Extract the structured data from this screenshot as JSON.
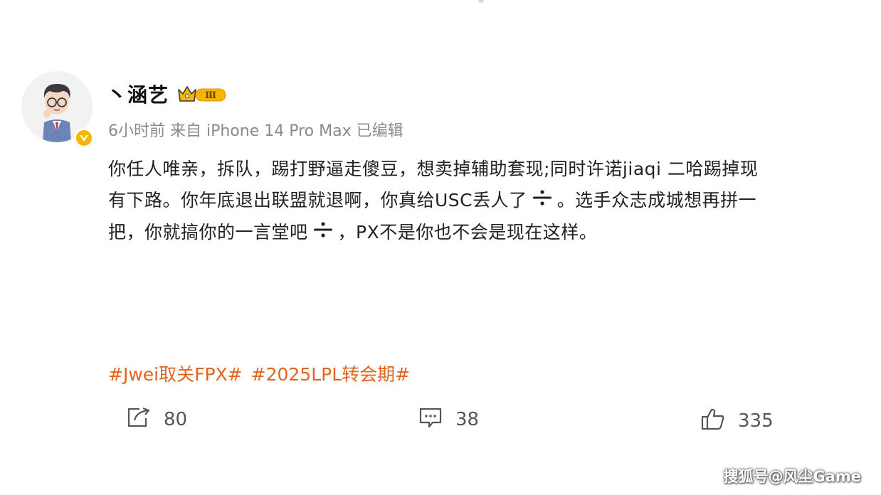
{
  "user": {
    "name": "丶涵艺",
    "vip_level": "Ⅲ"
  },
  "meta": "6小时前 来自 iPhone 14 Pro Max 已编辑",
  "content": {
    "line1": "你任人唯亲，拆队，踢打野逼走傻豆，想卖掉辅助套现;同时许诺jiaqi 二哈踢掉现",
    "line2a": "有下路。你年底退出联盟就退啊，你真给USC丢人了",
    "line2b": "。选手众志成城想再拼一",
    "line3a": "把，你就搞你的一言堂吧",
    "line3b": "，PX不是你也不会是现在这样。"
  },
  "hashtags": [
    "#Jwei取关FPX#",
    "#2025LPL转会期#"
  ],
  "actions": {
    "repost_count": "80",
    "comment_count": "38",
    "like_count": "335"
  },
  "watermark": "搜狐号@风尘Game",
  "colors": {
    "hashtag": "#e2641f",
    "meta": "#8a8a8a",
    "badge": "#f7b500"
  },
  "icons": {
    "repost": "repost-icon",
    "comment": "comment-icon",
    "like": "thumbs-up-icon",
    "emoji": "divide-emoji-icon",
    "verified": "verified-badge-icon",
    "vip": "crown-vip-icon"
  }
}
